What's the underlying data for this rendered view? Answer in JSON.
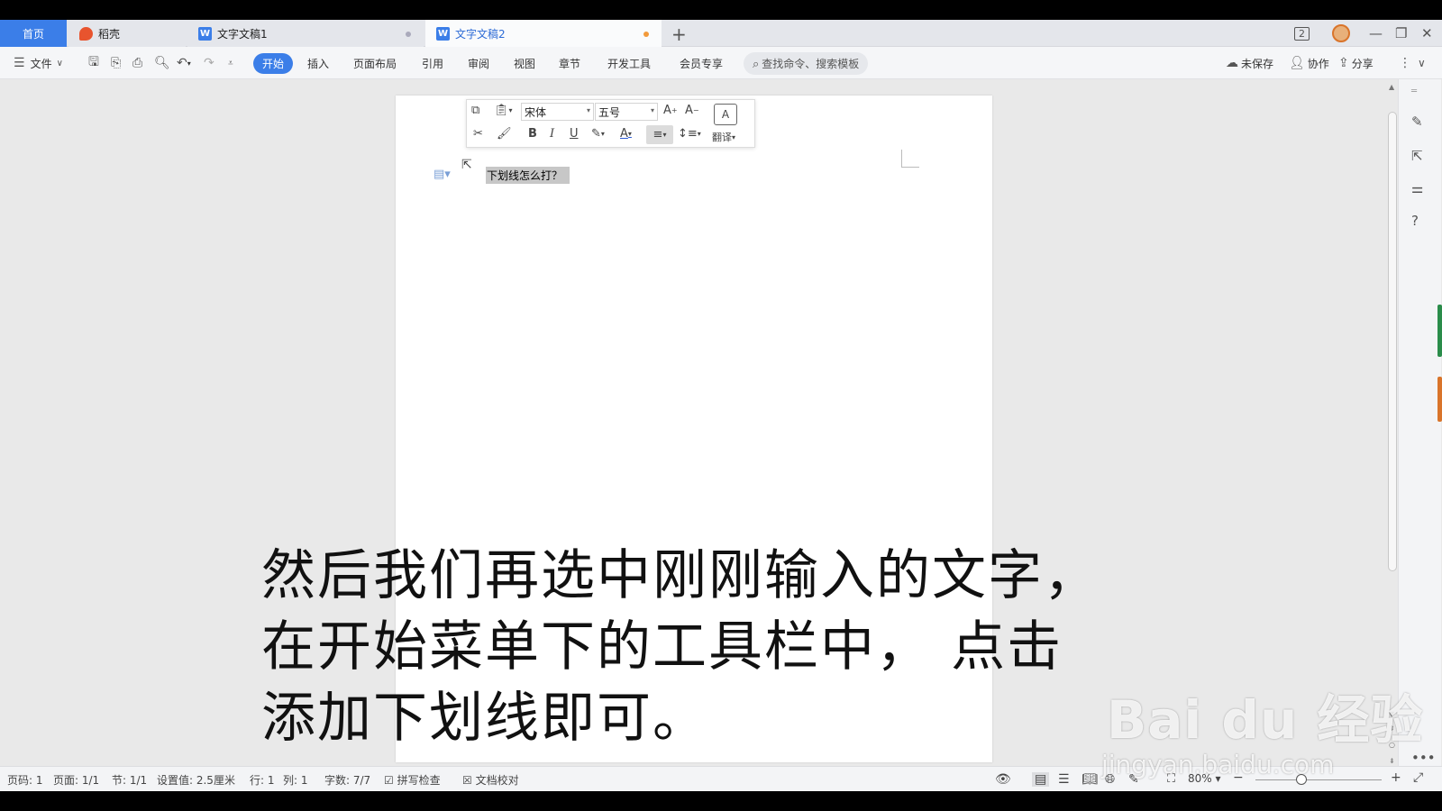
{
  "tabs": {
    "home": "首页",
    "daoke": "稻壳",
    "doc1": "文字文稿1",
    "doc2": "文字文稿2",
    "window_count": "2"
  },
  "toolbar": {
    "file": "文件",
    "start": "开始",
    "insert": "插入",
    "layout": "页面布局",
    "reference": "引用",
    "review": "审阅",
    "view": "视图",
    "chapter": "章节",
    "devtools": "开发工具",
    "member": "会员专享",
    "search_placeholder": "查找命令、搜索模板",
    "unsaved": "未保存",
    "collab": "协作",
    "share": "分享"
  },
  "minibar": {
    "font": "宋体",
    "size": "五号",
    "translate": "翻译"
  },
  "document": {
    "text": "下划线怎么打？"
  },
  "status": {
    "page_no": "页码: 1",
    "pages": "页面: 1/1",
    "section": "节: 1/1",
    "setting": "设置值: 2.5厘米",
    "row": "行: 1",
    "col": "列: 1",
    "words": "字数: 7/7",
    "spell": "拼写检查",
    "proof": "文档校对",
    "zoom": "80%"
  },
  "caption": {
    "line1": "然后我们再选中刚刚输入的文字，",
    "line2": "在开始菜单下的工具栏中， 点击",
    "line3": "添加下划线即可。"
  },
  "watermark": {
    "logo": "Bai du 经验",
    "url": "jingyan.baidu.com"
  }
}
